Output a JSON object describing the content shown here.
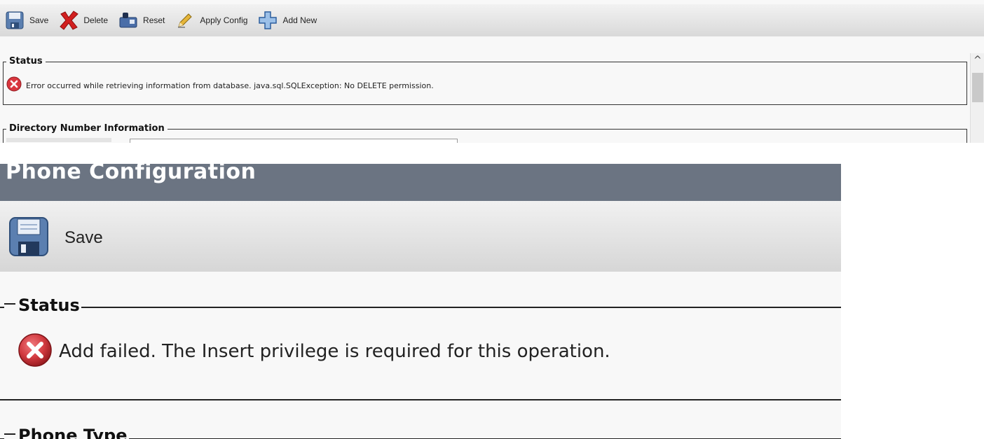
{
  "panel1": {
    "toolbar": {
      "save_label": "Save",
      "delete_label": "Delete",
      "reset_label": "Reset",
      "apply_config_label": "Apply Config",
      "add_new_label": "Add New"
    },
    "status": {
      "legend": "Status",
      "error_message": "Error occurred while retrieving information from database. java.sql.SQLException: No DELETE permission."
    },
    "directory_number": {
      "legend": "Directory Number Information"
    },
    "scroll_up_glyph": "^"
  },
  "panel2": {
    "title": "Phone Configuration",
    "toolbar": {
      "save_label": "Save"
    },
    "status": {
      "legend": "Status",
      "error_message": "Add failed. The Insert privilege is required for this operation."
    },
    "phone_type": {
      "legend": "Phone Type"
    }
  },
  "colors": {
    "header_bg": "#6b7482",
    "error_red": "#d9363e",
    "toolbar_top": "#f2f2f2",
    "toolbar_bottom": "#d9d9d9"
  },
  "icons": [
    "floppy-disk-icon",
    "red-x-delete-icon",
    "reset-phone-icon",
    "pencil-icon",
    "blue-plus-icon",
    "error-circle-icon"
  ]
}
